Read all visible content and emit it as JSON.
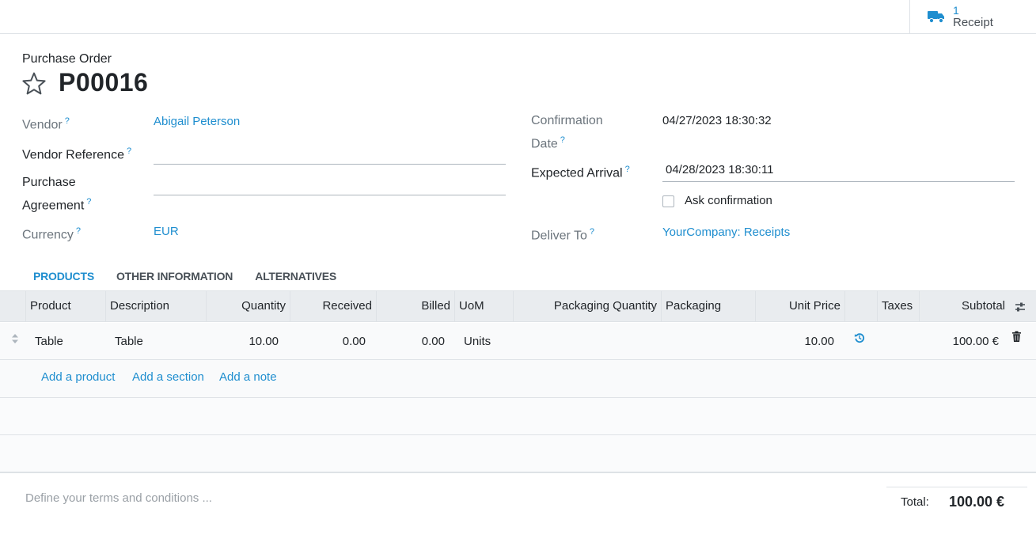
{
  "smart_button": {
    "count": "1",
    "label": "Receipt",
    "icon": "truck-icon"
  },
  "header": {
    "doc_type": "Purchase Order",
    "name": "P00016"
  },
  "left_fields": {
    "vendor": {
      "label": "Vendor",
      "help": "?",
      "value": "Abigail Peterson"
    },
    "vendor_reference": {
      "label": "Vendor Reference",
      "help": "?",
      "value": ""
    },
    "purchase_agreement": {
      "label_line1": "Purchase",
      "label_line2": "Agreement",
      "help": "?",
      "value": ""
    },
    "currency": {
      "label": "Currency",
      "help": "?",
      "value": "EUR"
    }
  },
  "right_fields": {
    "confirmation_date": {
      "label_line1": "Confirmation",
      "label_line2": "Date",
      "help": "?",
      "value": "04/27/2023 18:30:32"
    },
    "expected_arrival": {
      "label": "Expected Arrival",
      "help": "?",
      "value": "04/28/2023 18:30:11"
    },
    "ask_confirmation": {
      "label": "Ask confirmation",
      "checked": false
    },
    "deliver_to": {
      "label": "Deliver To",
      "help": "?",
      "value": "YourCompany: Receipts"
    }
  },
  "tabs": [
    {
      "label": "PRODUCTS",
      "active": true
    },
    {
      "label": "OTHER INFORMATION",
      "active": false
    },
    {
      "label": "ALTERNATIVES",
      "active": false
    }
  ],
  "table": {
    "columns": [
      "Product",
      "Description",
      "Quantity",
      "Received",
      "Billed",
      "UoM",
      "Packaging Quantity",
      "Packaging",
      "Unit Price",
      "Taxes",
      "Subtotal"
    ],
    "rows": [
      {
        "product": "Table",
        "description": "Table",
        "quantity": "10.00",
        "received": "0.00",
        "billed": "0.00",
        "uom": "Units",
        "packaging_quantity": "",
        "packaging": "",
        "unit_price": "10.00",
        "taxes": "",
        "subtotal": "100.00 €"
      }
    ],
    "add_product": "Add a product",
    "add_section": "Add a section",
    "add_note": "Add a note"
  },
  "footer": {
    "terms_placeholder": "Define your terms and conditions ...",
    "total_label": "Total:",
    "total_value": "100.00 €"
  },
  "colors": {
    "link": "#1f8ecf",
    "header_bg": "#e9ecef"
  }
}
